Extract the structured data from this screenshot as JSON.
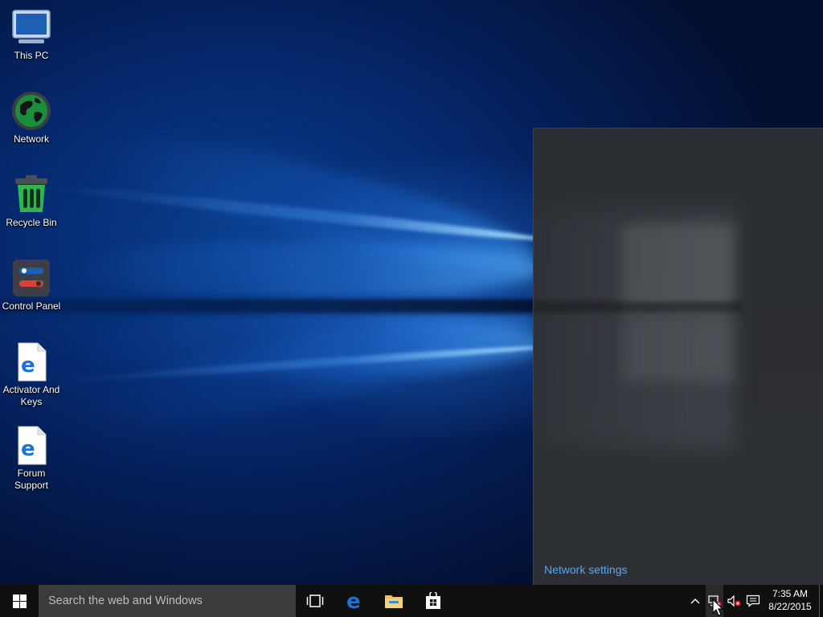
{
  "desktop": {
    "icons": [
      {
        "label": "This PC",
        "icon": "monitor-icon"
      },
      {
        "label": "Network",
        "icon": "globe-icon"
      },
      {
        "label": "Recycle Bin",
        "icon": "recycle-bin-icon"
      },
      {
        "label": "Control Panel",
        "icon": "control-panel-icon"
      },
      {
        "label": "Activator And Keys",
        "icon": "edge-document-icon"
      },
      {
        "label": "Forum Support",
        "icon": "edge-document-icon"
      }
    ]
  },
  "network_flyout": {
    "settings_link": "Network settings"
  },
  "taskbar": {
    "start_icon": "windows-logo-icon",
    "search_placeholder": "Search the web and Windows",
    "pinned": [
      {
        "name": "task-view",
        "icon": "task-view-icon"
      },
      {
        "name": "edge",
        "icon": "edge-icon"
      },
      {
        "name": "file-explorer",
        "icon": "folder-icon"
      },
      {
        "name": "store",
        "icon": "store-icon"
      }
    ],
    "tray": {
      "icons": [
        "chevron-up-icon",
        "network-disconnected-icon",
        "volume-muted-icon",
        "action-center-icon"
      ],
      "time": "7:35 AM",
      "date": "8/22/2015"
    }
  },
  "colors": {
    "accent_link": "#5fa8ea",
    "taskbar": "#101010",
    "flyout_bg": "#2b2e33",
    "edge_blue": "#1e73d2",
    "folder_yellow": "#f2c14e",
    "status_error": "#e81123"
  }
}
